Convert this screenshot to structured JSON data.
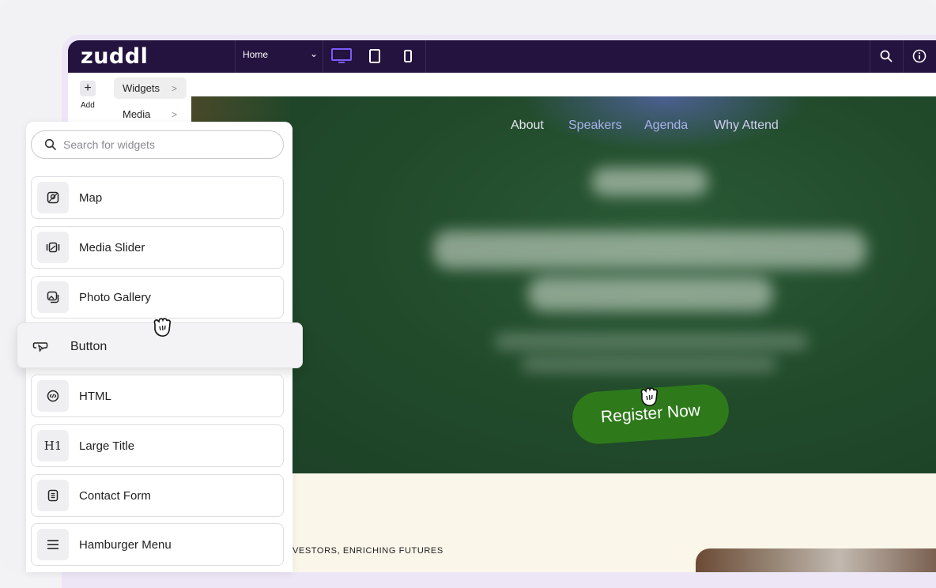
{
  "app": {
    "logo": "zuddl"
  },
  "toolbar": {
    "page_select": "Home",
    "chevron": "⌄"
  },
  "rail": {
    "add_label": "Add",
    "add_symbol": "+"
  },
  "categories": [
    {
      "label": "Widgets",
      "arrow": ">"
    },
    {
      "label": "Media",
      "arrow": ">"
    }
  ],
  "widget_panel": {
    "search_placeholder": "Search for widgets",
    "items": [
      {
        "label": "Map",
        "icon": "map-icon"
      },
      {
        "label": "Media Slider",
        "icon": "media-slider-icon"
      },
      {
        "label": "Photo Gallery",
        "icon": "photo-gallery-icon"
      },
      {
        "label": "Button",
        "icon": "button-icon"
      },
      {
        "label": "HTML",
        "icon": "html-icon"
      },
      {
        "label": "Large Title",
        "icon": "large-title-icon"
      },
      {
        "label": "Contact Form",
        "icon": "contact-form-icon"
      },
      {
        "label": "Hamburger Menu",
        "icon": "hamburger-menu-icon"
      }
    ],
    "large_title_glyph": "H1"
  },
  "site": {
    "nav": [
      {
        "label": "About",
        "color": "#e6e6ee"
      },
      {
        "label": "Speakers",
        "color": "#a9b2ee"
      },
      {
        "label": "Agenda",
        "color": "#a9b2ee"
      },
      {
        "label": "Why Attend",
        "color": "#d0d0ee"
      }
    ],
    "register_label": "Register Now",
    "tagline": "VESTORS, ENRICHING FUTURES"
  },
  "colors": {
    "topbar": "#24123f",
    "accent": "#7b5cf5",
    "register": "#2e7a1b",
    "hero": "#214a2b"
  }
}
